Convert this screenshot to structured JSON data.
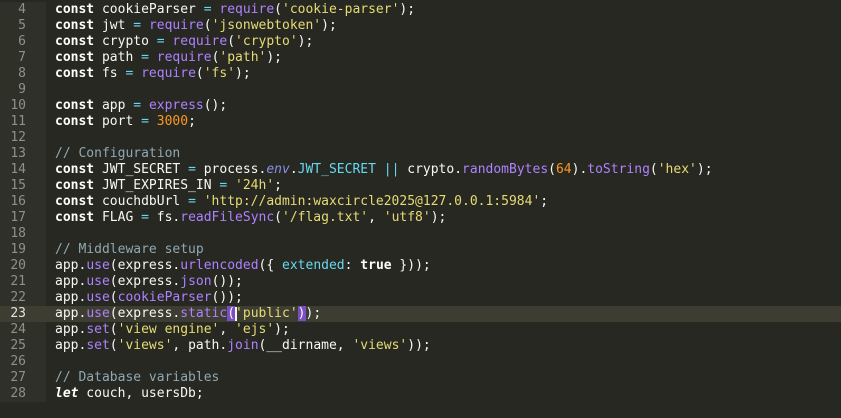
{
  "editor": {
    "current_line": "23",
    "colors": {
      "background": "#272822",
      "keyword": "#ffffff",
      "string": "#e6db74",
      "function": "#ae81ff",
      "number": "#fd971f",
      "comment": "#8fa8b3",
      "operator": "#66d9ef",
      "bracket_match": "#7a4fc4"
    },
    "lines": [
      {
        "no": "4",
        "tokens": [
          {
            "t": "kw",
            "v": "const"
          },
          {
            "t": "id",
            "v": " cookieParser "
          },
          {
            "t": "op",
            "v": "="
          },
          {
            "t": "id",
            "v": " "
          },
          {
            "t": "fn",
            "v": "require"
          },
          {
            "t": "punc",
            "v": "("
          },
          {
            "t": "str",
            "v": "'cookie-parser'"
          },
          {
            "t": "punc",
            "v": ");"
          }
        ]
      },
      {
        "no": "5",
        "tokens": [
          {
            "t": "kw",
            "v": "const"
          },
          {
            "t": "id",
            "v": " jwt "
          },
          {
            "t": "op",
            "v": "="
          },
          {
            "t": "id",
            "v": " "
          },
          {
            "t": "fn",
            "v": "require"
          },
          {
            "t": "punc",
            "v": "("
          },
          {
            "t": "str",
            "v": "'jsonwebtoken'"
          },
          {
            "t": "punc",
            "v": ");"
          }
        ]
      },
      {
        "no": "6",
        "tokens": [
          {
            "t": "kw",
            "v": "const"
          },
          {
            "t": "id",
            "v": " crypto "
          },
          {
            "t": "op",
            "v": "="
          },
          {
            "t": "id",
            "v": " "
          },
          {
            "t": "fn",
            "v": "require"
          },
          {
            "t": "punc",
            "v": "("
          },
          {
            "t": "str",
            "v": "'crypto'"
          },
          {
            "t": "punc",
            "v": ");"
          }
        ]
      },
      {
        "no": "7",
        "tokens": [
          {
            "t": "kw",
            "v": "const"
          },
          {
            "t": "id",
            "v": " path "
          },
          {
            "t": "op",
            "v": "="
          },
          {
            "t": "id",
            "v": " "
          },
          {
            "t": "fn",
            "v": "require"
          },
          {
            "t": "punc",
            "v": "("
          },
          {
            "t": "str",
            "v": "'path'"
          },
          {
            "t": "punc",
            "v": ");"
          }
        ]
      },
      {
        "no": "8",
        "tokens": [
          {
            "t": "kw",
            "v": "const"
          },
          {
            "t": "id",
            "v": " fs "
          },
          {
            "t": "op",
            "v": "="
          },
          {
            "t": "id",
            "v": " "
          },
          {
            "t": "fn",
            "v": "require"
          },
          {
            "t": "punc",
            "v": "("
          },
          {
            "t": "str",
            "v": "'fs'"
          },
          {
            "t": "punc",
            "v": ");"
          }
        ]
      },
      {
        "no": "9",
        "tokens": []
      },
      {
        "no": "10",
        "tokens": [
          {
            "t": "kw",
            "v": "const"
          },
          {
            "t": "id",
            "v": " app "
          },
          {
            "t": "op",
            "v": "="
          },
          {
            "t": "id",
            "v": " "
          },
          {
            "t": "fn",
            "v": "express"
          },
          {
            "t": "punc",
            "v": "();"
          }
        ]
      },
      {
        "no": "11",
        "tokens": [
          {
            "t": "kw",
            "v": "const"
          },
          {
            "t": "id",
            "v": " port "
          },
          {
            "t": "op",
            "v": "="
          },
          {
            "t": "id",
            "v": " "
          },
          {
            "t": "num",
            "v": "3000"
          },
          {
            "t": "punc",
            "v": ";"
          }
        ]
      },
      {
        "no": "12",
        "tokens": []
      },
      {
        "no": "13",
        "tokens": [
          {
            "t": "com",
            "v": "// Configuration"
          }
        ]
      },
      {
        "no": "14",
        "tokens": [
          {
            "t": "kw",
            "v": "const"
          },
          {
            "t": "id",
            "v": " JWT_SECRET "
          },
          {
            "t": "op",
            "v": "="
          },
          {
            "t": "id",
            "v": " process."
          },
          {
            "t": "prop",
            "v": "env"
          },
          {
            "t": "id",
            "v": "."
          },
          {
            "t": "const",
            "v": "JWT_SECRET"
          },
          {
            "t": "id",
            "v": " "
          },
          {
            "t": "op",
            "v": "||"
          },
          {
            "t": "id",
            "v": " crypto."
          },
          {
            "t": "fn",
            "v": "randomBytes"
          },
          {
            "t": "punc",
            "v": "("
          },
          {
            "t": "num",
            "v": "64"
          },
          {
            "t": "punc",
            "v": ")."
          },
          {
            "t": "fn",
            "v": "toString"
          },
          {
            "t": "punc",
            "v": "("
          },
          {
            "t": "str",
            "v": "'hex'"
          },
          {
            "t": "punc",
            "v": ");"
          }
        ]
      },
      {
        "no": "15",
        "tokens": [
          {
            "t": "kw",
            "v": "const"
          },
          {
            "t": "id",
            "v": " JWT_EXPIRES_IN "
          },
          {
            "t": "op",
            "v": "="
          },
          {
            "t": "id",
            "v": " "
          },
          {
            "t": "str",
            "v": "'24h'"
          },
          {
            "t": "punc",
            "v": ";"
          }
        ]
      },
      {
        "no": "16",
        "tokens": [
          {
            "t": "kw",
            "v": "const"
          },
          {
            "t": "id",
            "v": " couchdbUrl "
          },
          {
            "t": "op",
            "v": "="
          },
          {
            "t": "id",
            "v": " "
          },
          {
            "t": "str",
            "v": "'http://admin:waxcircle2025@127.0.0.1:5984'"
          },
          {
            "t": "punc",
            "v": ";"
          }
        ]
      },
      {
        "no": "17",
        "tokens": [
          {
            "t": "kw",
            "v": "const"
          },
          {
            "t": "id",
            "v": " FLAG "
          },
          {
            "t": "op",
            "v": "="
          },
          {
            "t": "id",
            "v": " fs."
          },
          {
            "t": "fn",
            "v": "readFileSync"
          },
          {
            "t": "punc",
            "v": "("
          },
          {
            "t": "str",
            "v": "'/flag.txt'"
          },
          {
            "t": "punc",
            "v": ", "
          },
          {
            "t": "str",
            "v": "'utf8'"
          },
          {
            "t": "punc",
            "v": ");"
          }
        ]
      },
      {
        "no": "18",
        "tokens": []
      },
      {
        "no": "19",
        "tokens": [
          {
            "t": "com",
            "v": "// Middleware setup"
          }
        ]
      },
      {
        "no": "20",
        "tokens": [
          {
            "t": "id",
            "v": "app."
          },
          {
            "t": "fn",
            "v": "use"
          },
          {
            "t": "punc",
            "v": "(express."
          },
          {
            "t": "fn",
            "v": "urlencoded"
          },
          {
            "t": "punc",
            "v": "({ "
          },
          {
            "t": "const",
            "v": "extended"
          },
          {
            "t": "punc",
            "v": ": "
          },
          {
            "t": "bool",
            "v": "true"
          },
          {
            "t": "punc",
            "v": " }));"
          }
        ]
      },
      {
        "no": "21",
        "tokens": [
          {
            "t": "id",
            "v": "app."
          },
          {
            "t": "fn",
            "v": "use"
          },
          {
            "t": "punc",
            "v": "(express."
          },
          {
            "t": "fn",
            "v": "json"
          },
          {
            "t": "punc",
            "v": "());"
          }
        ]
      },
      {
        "no": "22",
        "tokens": [
          {
            "t": "id",
            "v": "app."
          },
          {
            "t": "fn",
            "v": "use"
          },
          {
            "t": "punc",
            "v": "("
          },
          {
            "t": "fn",
            "v": "cookieParser"
          },
          {
            "t": "punc",
            "v": "());"
          }
        ]
      },
      {
        "no": "23",
        "tokens": [
          {
            "t": "id",
            "v": "app."
          },
          {
            "t": "fn",
            "v": "use"
          },
          {
            "t": "punc",
            "v": "(express."
          },
          {
            "t": "fn",
            "v": "static"
          },
          {
            "t": "brm",
            "v": "("
          },
          {
            "t": "cursor",
            "v": ""
          },
          {
            "t": "str",
            "v": "'public'"
          },
          {
            "t": "brm",
            "v": ")"
          },
          {
            "t": "punc",
            "v": ");"
          }
        ]
      },
      {
        "no": "24",
        "tokens": [
          {
            "t": "id",
            "v": "app."
          },
          {
            "t": "fn",
            "v": "set"
          },
          {
            "t": "punc",
            "v": "("
          },
          {
            "t": "str",
            "v": "'view engine'"
          },
          {
            "t": "punc",
            "v": ", "
          },
          {
            "t": "str",
            "v": "'ejs'"
          },
          {
            "t": "punc",
            "v": ");"
          }
        ]
      },
      {
        "no": "25",
        "tokens": [
          {
            "t": "id",
            "v": "app."
          },
          {
            "t": "fn",
            "v": "set"
          },
          {
            "t": "punc",
            "v": "("
          },
          {
            "t": "str",
            "v": "'views'"
          },
          {
            "t": "punc",
            "v": ", path."
          },
          {
            "t": "fn",
            "v": "join"
          },
          {
            "t": "punc",
            "v": "(__dirname, "
          },
          {
            "t": "str",
            "v": "'views'"
          },
          {
            "t": "punc",
            "v": "));"
          }
        ]
      },
      {
        "no": "26",
        "tokens": []
      },
      {
        "no": "27",
        "tokens": [
          {
            "t": "com",
            "v": "// Database variables"
          }
        ]
      },
      {
        "no": "28",
        "tokens": [
          {
            "t": "kwi",
            "v": "let"
          },
          {
            "t": "id",
            "v": " couch, usersDb;"
          }
        ]
      }
    ]
  }
}
